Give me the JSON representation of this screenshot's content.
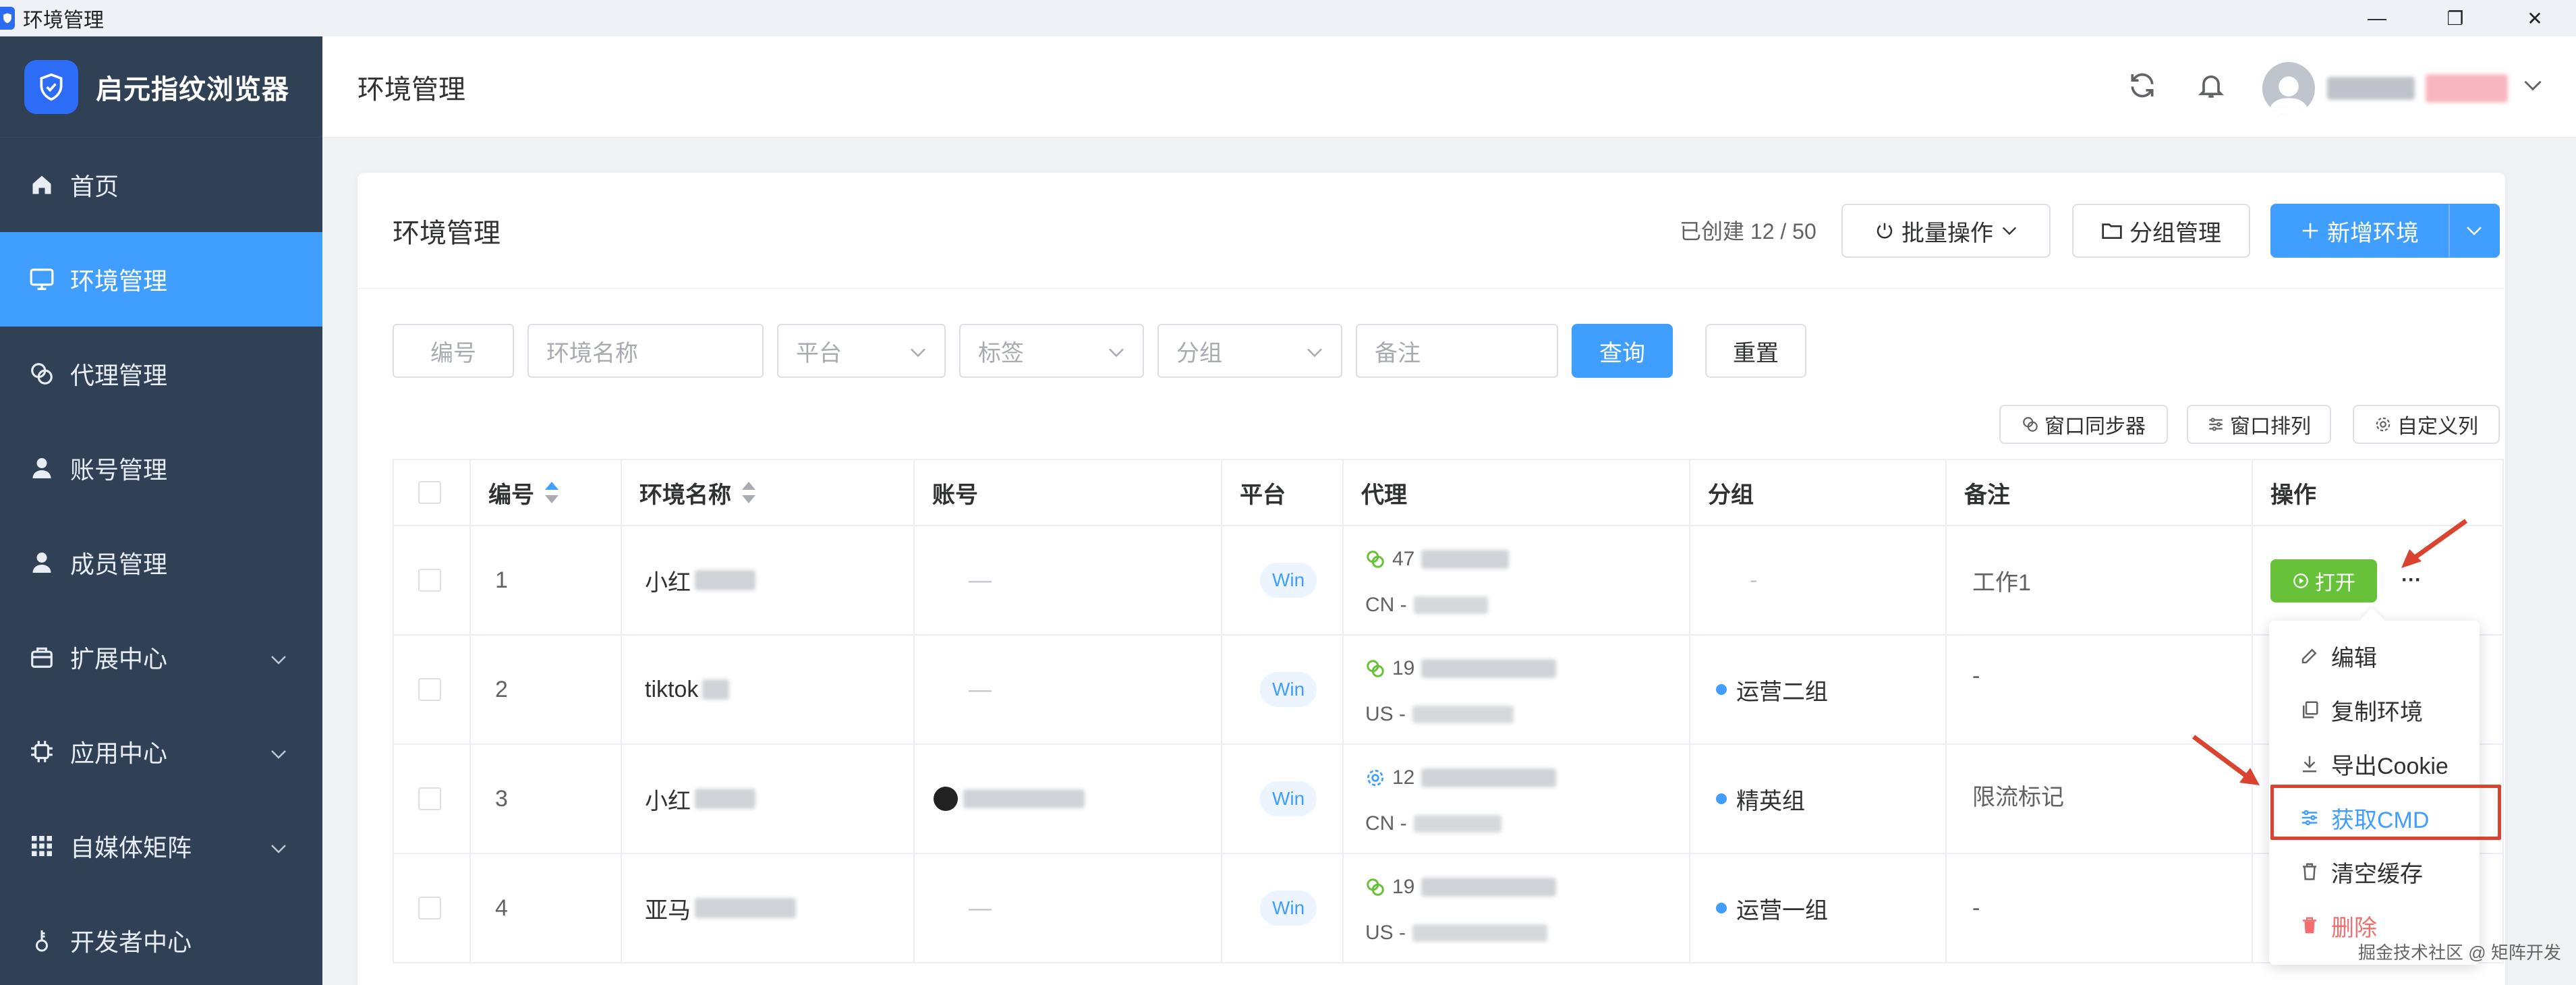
{
  "window": {
    "title": "环境管理",
    "minimize_glyph": "—",
    "maximize_glyph": "❐",
    "close_glyph": "✕"
  },
  "sidebar": {
    "brand": "启元指纹浏览器",
    "items": [
      {
        "label": "首页",
        "icon": "home-icon"
      },
      {
        "label": "环境管理",
        "icon": "monitor-icon"
      },
      {
        "label": "代理管理",
        "icon": "link-icon"
      },
      {
        "label": "账号管理",
        "icon": "user-icon"
      },
      {
        "label": "成员管理",
        "icon": "user-icon"
      },
      {
        "label": "扩展中心",
        "icon": "box-icon"
      },
      {
        "label": "应用中心",
        "icon": "chip-icon"
      },
      {
        "label": "自媒体矩阵",
        "icon": "grid-icon"
      },
      {
        "label": "开发者中心",
        "icon": "key-icon"
      }
    ]
  },
  "header": {
    "title": "环境管理"
  },
  "card": {
    "title": "环境管理",
    "created": "已创建 12 / 50",
    "batch_label": "批量操作",
    "group_mgmt_label": "分组管理",
    "new_env_label": "新增环境"
  },
  "filters": {
    "id_placeholder": "编号",
    "name_placeholder": "环境名称",
    "platform_placeholder": "平台",
    "tag_placeholder": "标签",
    "group_placeholder": "分组",
    "note_placeholder": "备注",
    "query_label": "查询",
    "reset_label": "重置"
  },
  "toolbar": {
    "sync_label": "窗口同步器",
    "arrange_label": "窗口排列",
    "custom_cols_label": "自定义列"
  },
  "table": {
    "columns": {
      "id": "编号",
      "name": "环境名称",
      "account": "账号",
      "platform": "平台",
      "proxy": "代理",
      "group": "分组",
      "note": "备注",
      "action": "操作"
    },
    "rows": [
      {
        "id": "1",
        "name": "小红",
        "account": "—",
        "platform": "Win",
        "proxy_ip": "47",
        "proxy_region": "CN -",
        "group": "-",
        "note": "工作1"
      },
      {
        "id": "2",
        "name": "tiktok",
        "account": "—",
        "platform": "Win",
        "proxy_ip": "19",
        "proxy_region": "US -",
        "group": "运营二组",
        "note": "-"
      },
      {
        "id": "3",
        "name": "小红",
        "account": "",
        "platform": "Win",
        "proxy_ip": "12",
        "proxy_region": "CN -",
        "group": "精英组",
        "note": "限流标记"
      },
      {
        "id": "4",
        "name": "亚马",
        "account": "—",
        "platform": "Win",
        "proxy_ip": "19",
        "proxy_region": "US -",
        "group": "运营一组",
        "note": "-"
      }
    ],
    "open_label": "打开",
    "more_glyph": "···"
  },
  "menu": {
    "items": [
      {
        "label": "编辑",
        "icon": "edit-icon"
      },
      {
        "label": "复制环境",
        "icon": "copy-icon"
      },
      {
        "label": "导出Cookie",
        "icon": "download-icon"
      },
      {
        "label": "获取CMD",
        "icon": "sliders-icon"
      },
      {
        "label": "清空缓存",
        "icon": "trash-icon"
      },
      {
        "label": "删除",
        "icon": "delete-icon"
      }
    ]
  },
  "watermark": "掘金技术社区 @ 矩阵开发",
  "colors": {
    "sidebar_bg": "#304156",
    "primary": "#409eff",
    "success": "#67c23a",
    "danger": "#f56c6c",
    "annotation_red": "#d9432f"
  }
}
